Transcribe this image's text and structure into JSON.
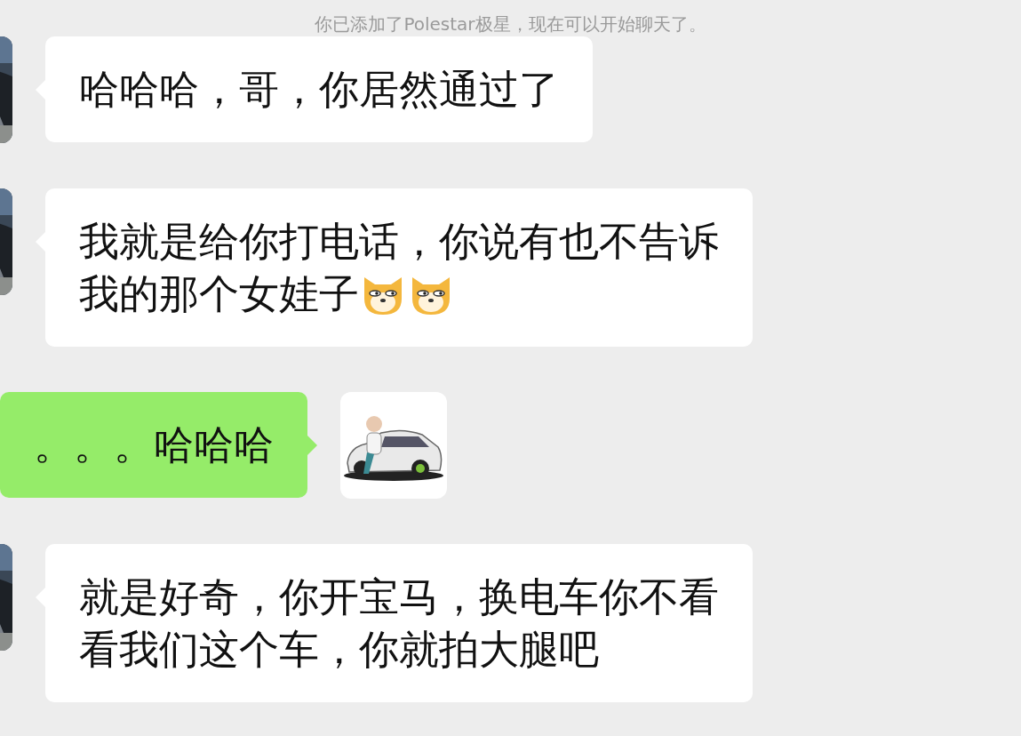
{
  "notice": "你已添加了Polestar极星，现在可以开始聊天了。",
  "messages": [
    {
      "kind": "incoming",
      "lines": [
        "哈哈哈，哥，你居然通过了"
      ],
      "avatar": {
        "kind": "picture"
      }
    },
    {
      "kind": "incoming",
      "lines": [
        "我就是给你打电话，你说有也不告诉",
        "我的那个女娃子"
      ],
      "emoji": [
        {
          "kind": "dog"
        },
        {
          "kind": "dog"
        }
      ],
      "avatar": {
        "kind": "picture"
      }
    },
    {
      "kind": "outgoing",
      "lines": [
        "。。。哈哈哈"
      ],
      "avatar": {
        "kind": "picture"
      }
    },
    {
      "kind": "incoming",
      "lines": [
        "就是好奇，你开宝马，换电车你不看",
        "看我们这个车，你就拍大腿吧"
      ],
      "avatar": {
        "kind": "picture"
      }
    }
  ]
}
